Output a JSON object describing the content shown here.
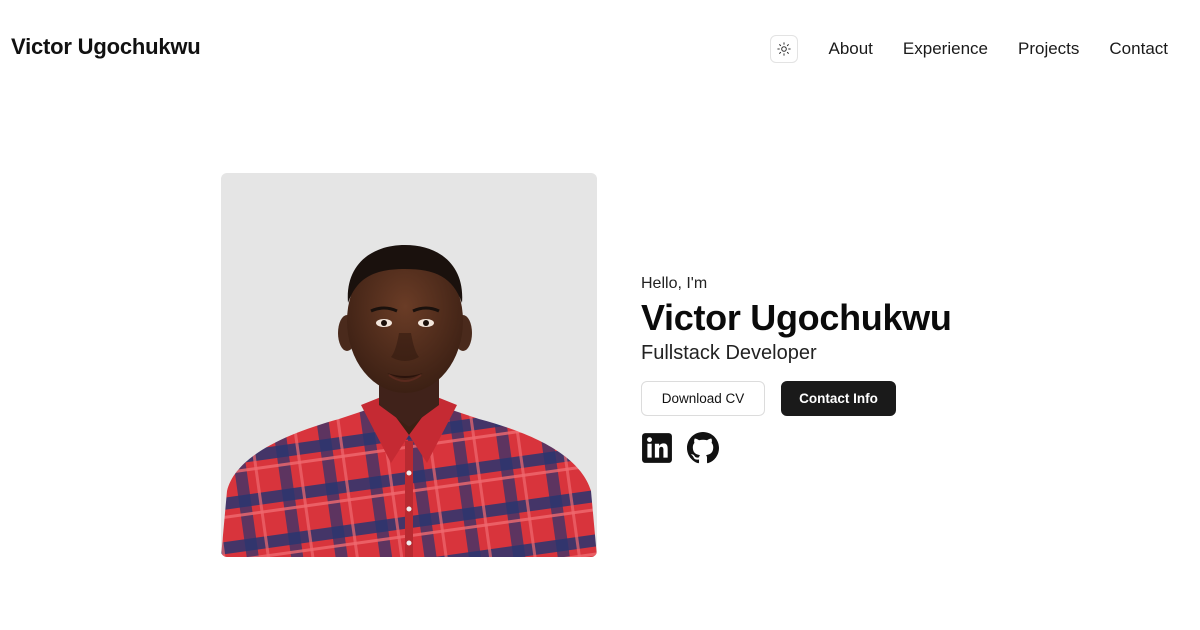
{
  "header": {
    "brand": "Victor Ugochukwu",
    "theme_icon": "sun-icon",
    "nav": [
      {
        "label": "About"
      },
      {
        "label": "Experience"
      },
      {
        "label": "Projects"
      },
      {
        "label": "Contact"
      }
    ]
  },
  "hero": {
    "greeting": "Hello, I'm",
    "name": "Victor Ugochukwu",
    "role": "Fullstack Developer",
    "download_cv_label": "Download CV",
    "contact_info_label": "Contact Info",
    "socials": [
      {
        "icon": "linkedin-icon"
      },
      {
        "icon": "github-icon"
      }
    ]
  },
  "colors": {
    "background": "#ffffff",
    "photo_background": "#e5e5e5",
    "dark_button": "#1a1a1a",
    "shirt_red": "#d8343c",
    "shirt_navy": "#2a3570"
  }
}
